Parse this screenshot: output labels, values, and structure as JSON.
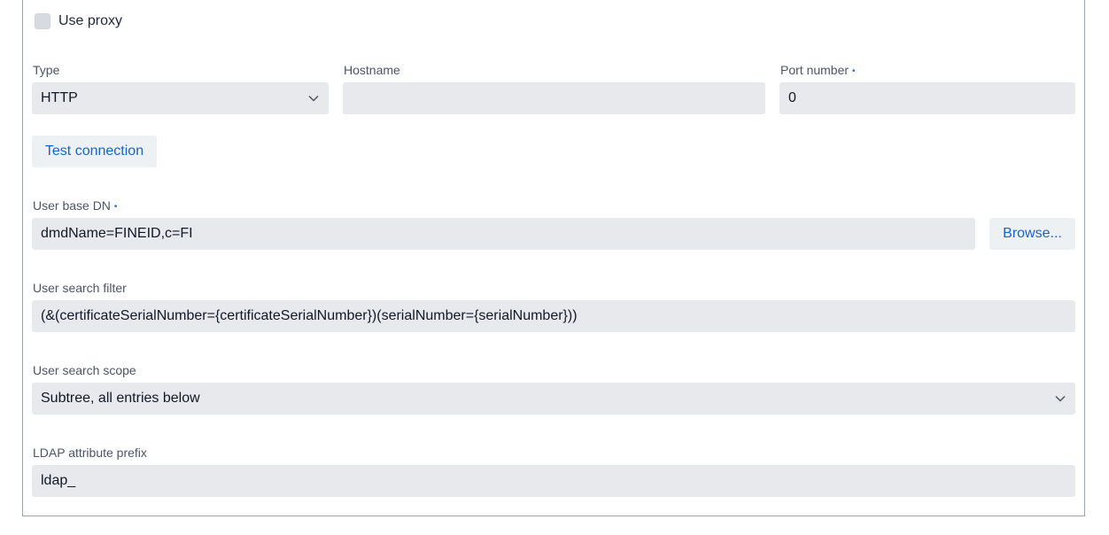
{
  "proxy": {
    "use_proxy_label": "Use proxy",
    "use_proxy_checked": false,
    "type_label": "Type",
    "type_value": "HTTP",
    "hostname_label": "Hostname",
    "hostname_value": "",
    "port_label": "Port number",
    "port_value": "0",
    "required_marker": "•"
  },
  "actions": {
    "test_connection_label": "Test connection",
    "browse_label": "Browse..."
  },
  "ldap": {
    "user_base_dn_label": "User base DN",
    "user_base_dn_value": "dmdName=FINEID,c=FI",
    "user_search_filter_label": "User search filter",
    "user_search_filter_value": "(&(certificateSerialNumber={certificateSerialNumber})(serialNumber={serialNumber}))",
    "user_search_scope_label": "User search scope",
    "user_search_scope_value": "Subtree, all entries below",
    "attribute_prefix_label": "LDAP attribute prefix",
    "attribute_prefix_value": "ldap_"
  },
  "icons": {
    "dropdown": "chevron-down-icon"
  },
  "colors": {
    "accent": "#1a64c6",
    "field_bg": "#e7e9ec",
    "required_dot": "#1a6fd1"
  }
}
